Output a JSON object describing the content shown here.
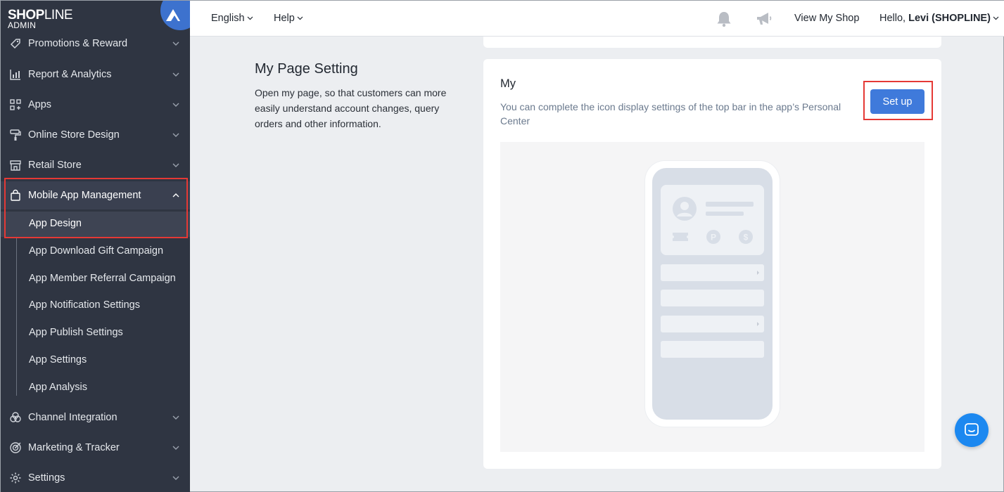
{
  "brand": {
    "name_bold": "SHOP",
    "name_thin": "LINE",
    "sub": "ADMIN"
  },
  "sidebar": {
    "items": [
      {
        "label": "Promotions & Reward",
        "icon": "tag-icon"
      },
      {
        "label": "Report & Analytics",
        "icon": "chart-icon"
      },
      {
        "label": "Apps",
        "icon": "apps-grid-icon"
      },
      {
        "label": "Online Store Design",
        "icon": "paint-roller-icon"
      },
      {
        "label": "Retail Store",
        "icon": "store-icon"
      },
      {
        "label": "Mobile App Management",
        "icon": "shopping-bag-icon",
        "expanded": true
      },
      {
        "label": "Channel Integration",
        "icon": "channels-icon"
      },
      {
        "label": "Marketing & Tracker",
        "icon": "target-icon"
      },
      {
        "label": "Settings",
        "icon": "gear-icon"
      }
    ],
    "subitems": [
      {
        "label": "App Design",
        "current": true
      },
      {
        "label": "App Download Gift Campaign"
      },
      {
        "label": "App Member Referral Campaign"
      },
      {
        "label": "App Notification Settings"
      },
      {
        "label": "App Publish Settings"
      },
      {
        "label": "App Settings"
      },
      {
        "label": "App Analysis"
      }
    ]
  },
  "topbar": {
    "language": "English",
    "help": "Help",
    "view_shop": "View My Shop",
    "greeting": "Hello,",
    "user": "Levi (SHOPLINE)"
  },
  "section": {
    "title": "My Page Setting",
    "description": "Open my page, so that customers can more easily understand account changes, query orders and other information."
  },
  "card": {
    "title": "My",
    "description": "You can complete the icon display settings of the top bar in the app’s Personal Center",
    "setup_button": "Set up"
  },
  "colors": {
    "sidebar_bg": "#2f3542",
    "accent_blue": "#3f7adb",
    "highlight_red": "#e53935",
    "chat_blue": "#1c88f0"
  }
}
